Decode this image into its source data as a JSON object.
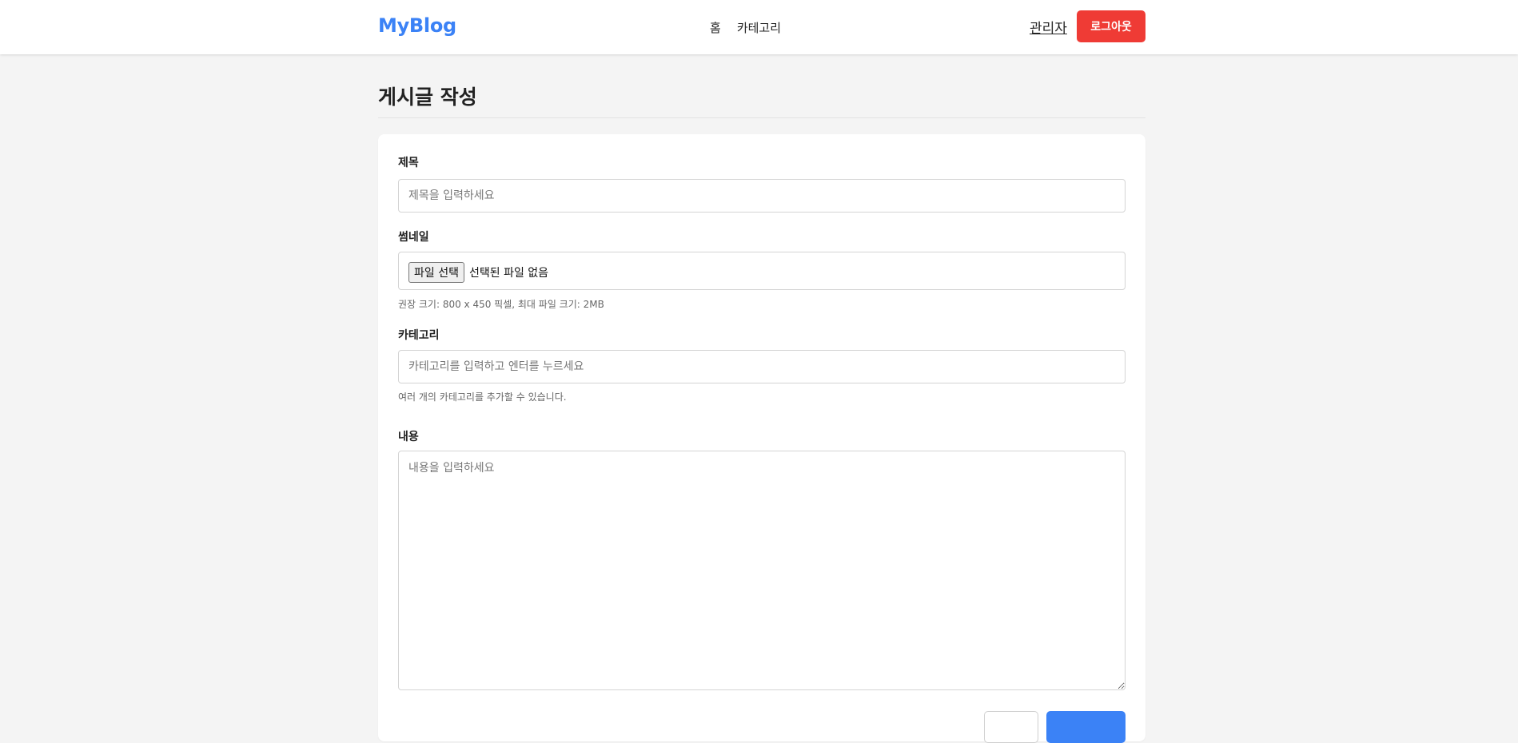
{
  "header": {
    "logo": "MyBlog",
    "nav": [
      {
        "label": "홈"
      },
      {
        "label": "카테고리"
      }
    ],
    "admin_label": "관리자",
    "logout_label": "로그아웃"
  },
  "page": {
    "title": "게시글 작성"
  },
  "form": {
    "title_field": {
      "label": "제목",
      "placeholder": "제목을 입력하세요",
      "value": ""
    },
    "thumbnail": {
      "label": "썸네일",
      "button_label": "파일 선택",
      "status": "선택된 파일 없음",
      "hint": "권장 크기: 800 x 450 픽셀, 최대 파일 크기: 2MB"
    },
    "category": {
      "label": "카테고리",
      "placeholder": "카테고리를 입력하고 엔터를 누르세요",
      "value": "",
      "hint": "여러 개의 카테고리를 추가할 수 있습니다."
    },
    "content": {
      "label": "내용",
      "placeholder": "내용을 입력하세요",
      "value": ""
    },
    "cancel_label": "",
    "submit_label": ""
  },
  "colors": {
    "brand": "#3b82f6",
    "danger": "#ef3b35",
    "page_bg": "#f4f4f4"
  }
}
